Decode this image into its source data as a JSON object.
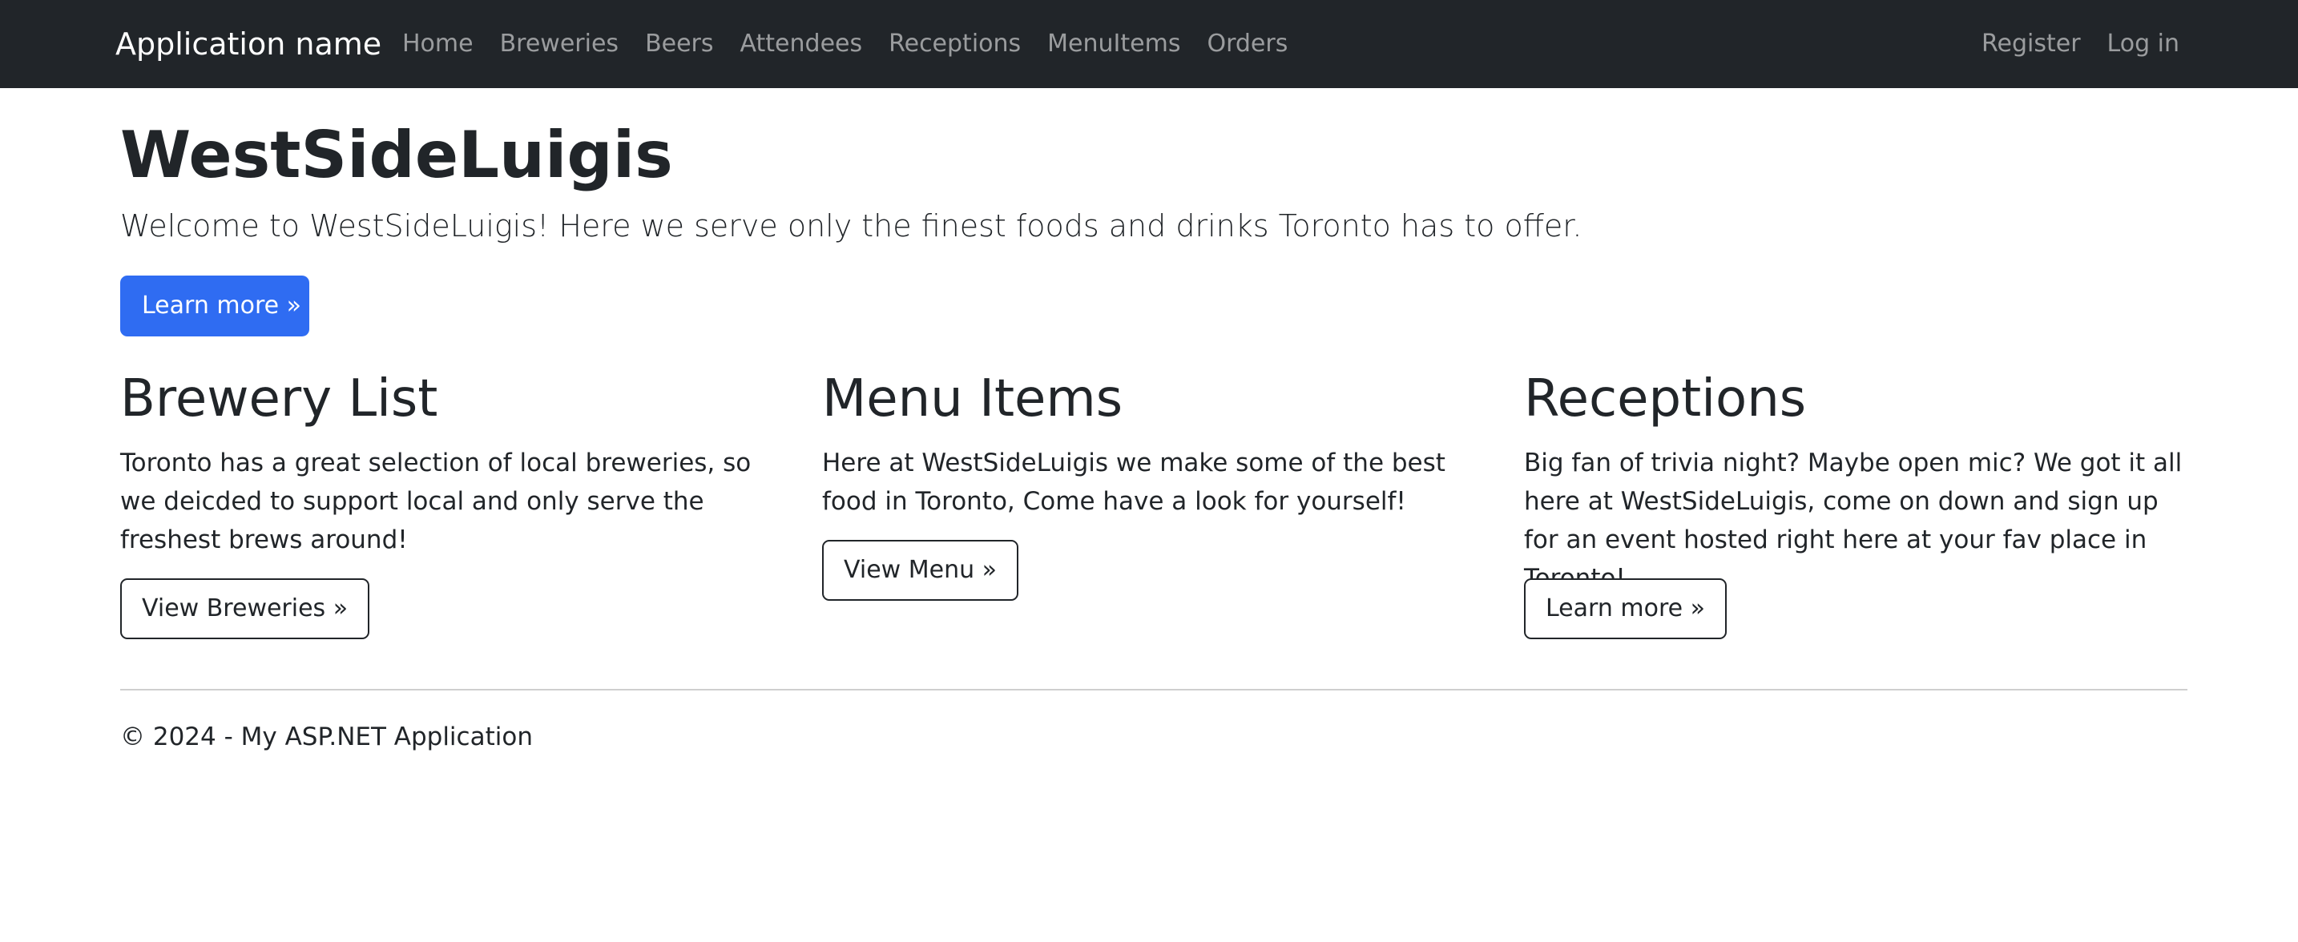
{
  "navbar": {
    "brand": "Application name",
    "left_links": [
      "Home",
      "Breweries",
      "Beers",
      "Attendees",
      "Receptions",
      "MenuItems",
      "Orders"
    ],
    "right_links": [
      "Register",
      "Log in"
    ]
  },
  "hero": {
    "title": "WestSideLuigis",
    "lead": "Welcome to WestSideLuigis! Here we serve only the finest foods and drinks Toronto has to offer.",
    "button_label": "Learn more »",
    "button_color": "#2f6cf2"
  },
  "columns": [
    {
      "heading": "Brewery List",
      "text": "Toronto has a great selection of local breweries, so we deicded to support local and only serve the freshest brews around!",
      "button_label": "View Breweries »"
    },
    {
      "heading": "Menu Items",
      "text": "Here at WestSideLuigis we make some of the best food in Toronto, Come have a look for yourself!",
      "button_label": "View Menu »"
    },
    {
      "heading": "Receptions",
      "text": "Big fan of trivia night? Maybe open mic? We got it all here at WestSideLuigis, come on down and sign up for an event hosted right here at your fav place in Toronto!",
      "button_label": "Learn more »"
    }
  ],
  "footer": {
    "text": "© 2024 - My ASP.NET Application"
  },
  "colors": {
    "navbar_bg": "#212529",
    "primary": "#2f6cf2"
  }
}
